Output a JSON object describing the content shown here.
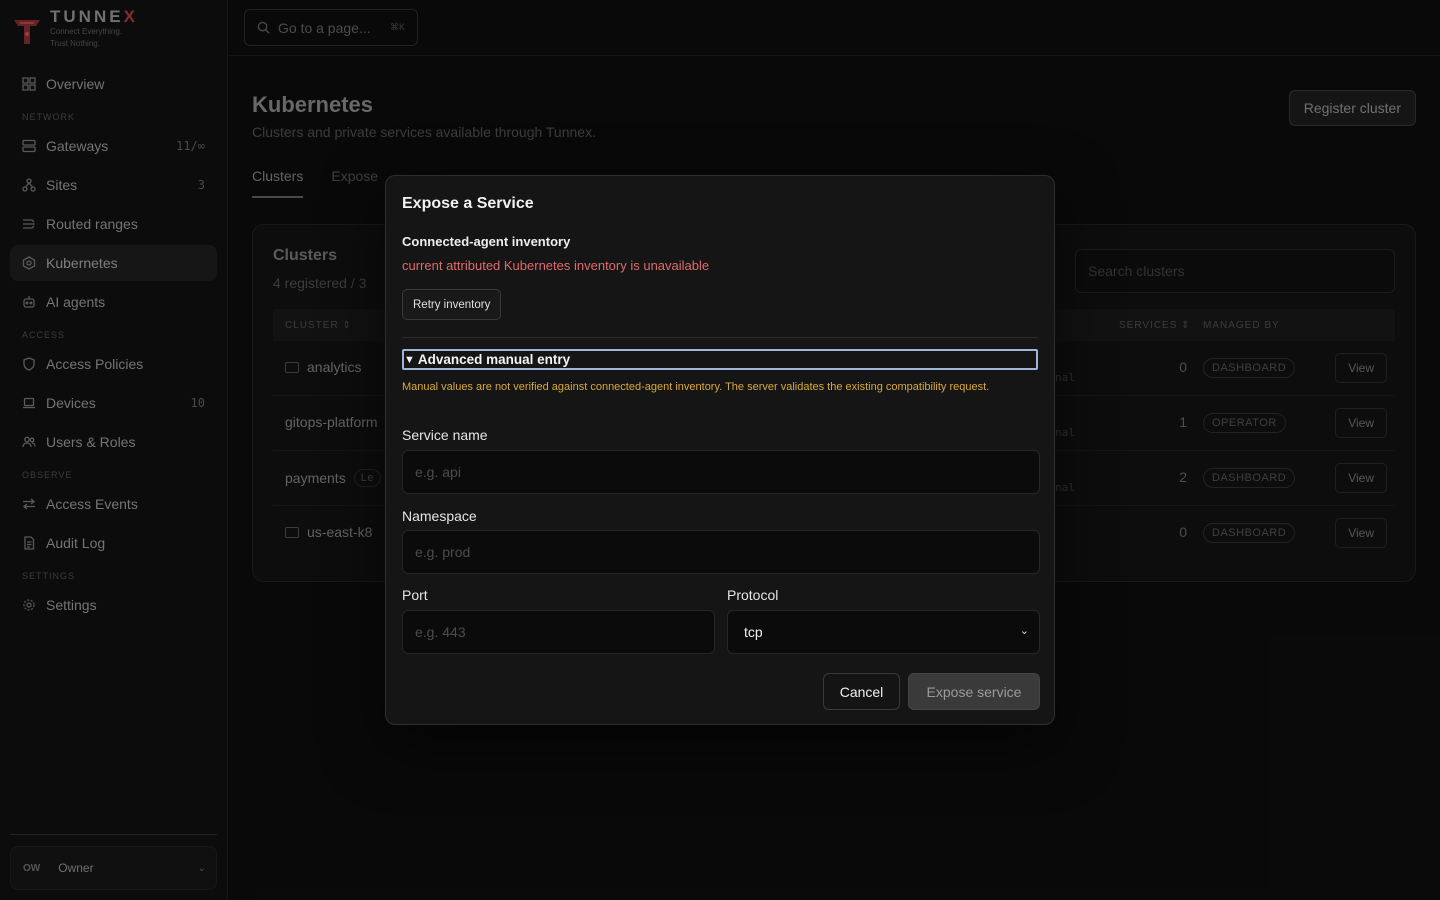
{
  "brand": {
    "name_prefix": "TUNN",
    "name_accent": "E",
    "name_suffix": "X",
    "tagline_1": "Connect Everything.",
    "tagline_2": "Trust Nothing."
  },
  "sidebar": {
    "overview": "Overview",
    "sections": {
      "network": "NETWORK",
      "access": "ACCESS",
      "observe": "OBSERVE",
      "settings": "SETTINGS"
    },
    "items": {
      "gateways": {
        "label": "Gateways",
        "count": "11/∞"
      },
      "sites": {
        "label": "Sites",
        "count": "3"
      },
      "routed_ranges": {
        "label": "Routed ranges"
      },
      "kubernetes": {
        "label": "Kubernetes"
      },
      "ai_agents": {
        "label": "AI agents"
      },
      "access_policies": {
        "label": "Access Policies"
      },
      "devices": {
        "label": "Devices",
        "count": "10"
      },
      "users_roles": {
        "label": "Users & Roles"
      },
      "access_events": {
        "label": "Access Events"
      },
      "audit_log": {
        "label": "Audit Log"
      },
      "settings": {
        "label": "Settings"
      }
    },
    "owner": {
      "avatar": "OW",
      "label": "Owner"
    }
  },
  "topbar": {
    "search_placeholder": "Go to a page...",
    "shortcut": "⌘K"
  },
  "page": {
    "title": "Kubernetes",
    "subtitle": "Clusters and private services available through Tunnex.",
    "register_button": "Register cluster",
    "tabs": [
      "Clusters",
      "Expose"
    ],
    "clusters_title": "Clusters",
    "clusters_sub": "4 registered  /  3",
    "search_placeholder": "Search clusters",
    "columns": {
      "cluster": "CLUSTER ⇕",
      "services": "SERVICES ⇕",
      "managed_by": "MANAGED BY"
    },
    "rows": [
      {
        "name": "analytics",
        "partial": "nal",
        "services": "0",
        "managed_by": "DASHBOARD",
        "action": "View"
      },
      {
        "name": "gitops-platform",
        "partial": "nal",
        "services": "1",
        "managed_by": "OPERATOR",
        "action": "View"
      },
      {
        "name": "payments",
        "tag": "Le",
        "partial": "nal",
        "services": "2",
        "managed_by": "DASHBOARD",
        "action": "View"
      },
      {
        "name": "us-east-k8",
        "partial": "",
        "services": "0",
        "managed_by": "DASHBOARD",
        "action": "View"
      }
    ]
  },
  "dialog": {
    "title": "Expose a Service",
    "inventory_title": "Connected-agent inventory",
    "inventory_error": "current attributed Kubernetes inventory is unavailable",
    "retry_button": "Retry inventory",
    "advanced_summary": "Advanced manual entry",
    "advanced_warning": "Manual values are not verified against connected-agent inventory. The server validates the existing compatibility request.",
    "fields": {
      "service_name": {
        "label": "Service name",
        "placeholder": "e.g. api"
      },
      "namespace": {
        "label": "Namespace",
        "placeholder": "e.g. prod"
      },
      "port": {
        "label": "Port",
        "placeholder": "e.g. 443"
      },
      "protocol": {
        "label": "Protocol",
        "value": "tcp"
      }
    },
    "cancel_button": "Cancel",
    "submit_button": "Expose service"
  },
  "colors": {
    "accent_error": "#e06a6a",
    "accent_warning": "#d9a93a",
    "focus_ring": "#9fb6d9",
    "brand_accent": "#a23a3a"
  }
}
